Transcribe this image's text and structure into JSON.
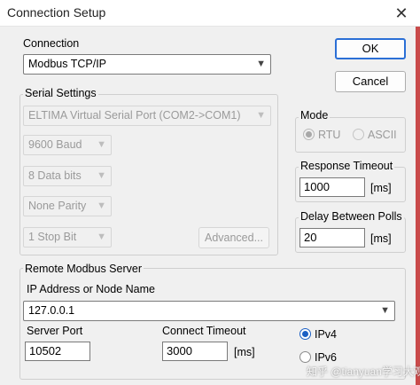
{
  "window": {
    "title": "Connection Setup",
    "close_icon": "close-icon"
  },
  "buttons": {
    "ok": "OK",
    "cancel": "Cancel"
  },
  "connection": {
    "label": "Connection",
    "value": "Modbus TCP/IP"
  },
  "serial": {
    "label": "Serial Settings",
    "port": "ELTIMA Virtual Serial Port (COM2->COM1)",
    "baud": "9600 Baud",
    "data_bits": "8 Data bits",
    "parity": "None Parity",
    "stop_bit": "1 Stop Bit",
    "advanced": "Advanced..."
  },
  "mode": {
    "label": "Mode",
    "rtu": "RTU",
    "ascii": "ASCII",
    "selected": "RTU"
  },
  "response_timeout": {
    "label": "Response Timeout",
    "value": "1000",
    "unit": "[ms]"
  },
  "delay_polls": {
    "label": "Delay Between Polls",
    "value": "20",
    "unit": "[ms]"
  },
  "remote": {
    "label": "Remote Modbus Server",
    "ip_label": "IP Address or Node Name",
    "ip_value": "127.0.0.1",
    "port_label": "Server Port",
    "port_value": "10502",
    "timeout_label": "Connect Timeout",
    "timeout_value": "3000",
    "timeout_unit": "[ms]",
    "ipv4": "IPv4",
    "ipv6": "IPv6",
    "selected": "IPv4"
  },
  "watermark": "知乎 @tianyuan学习大观"
}
